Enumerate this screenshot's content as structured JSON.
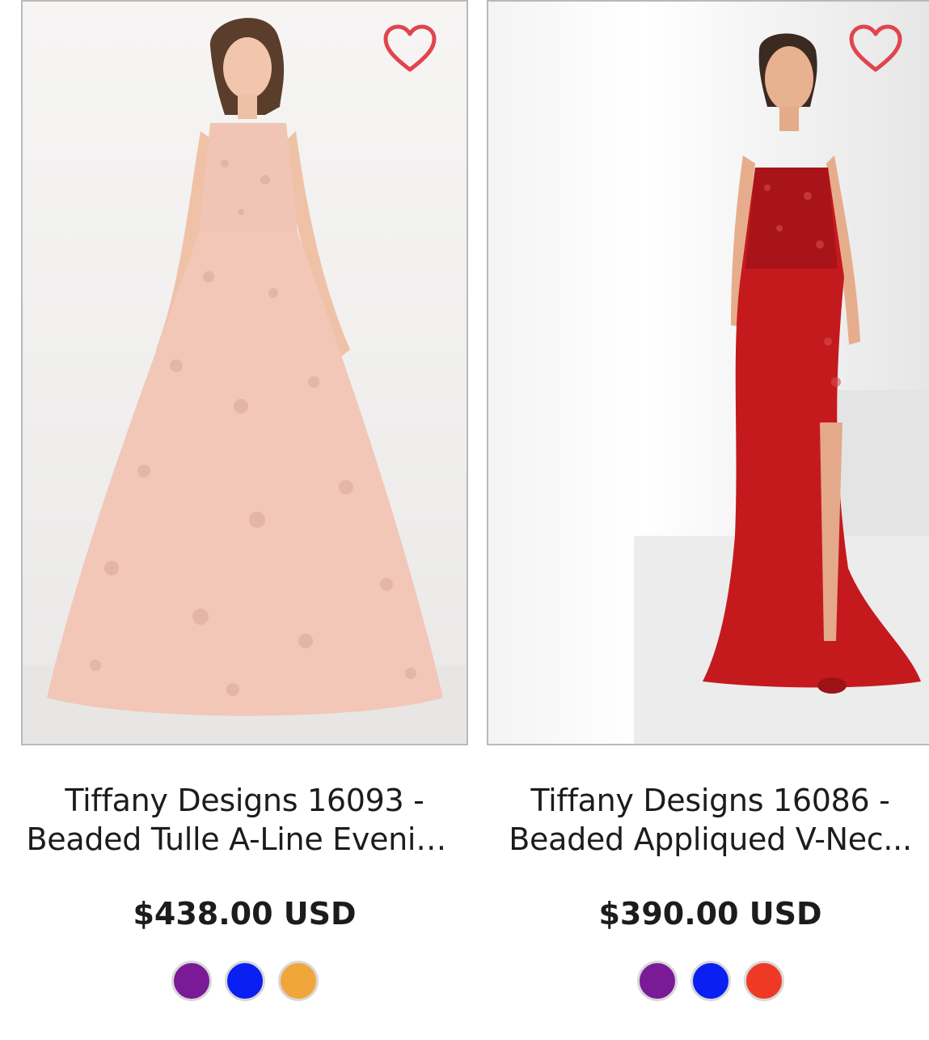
{
  "products": [
    {
      "title_line1": "Tiffany Designs 16093 -",
      "title_line2": "Beaded Tulle A-Line Evenin...",
      "price": "$438.00 USD",
      "swatches": [
        "#7a1a96",
        "#0a1ff2",
        "#f0a63a"
      ],
      "dress_color": "#f2c7b8"
    },
    {
      "title_line1": "Tiffany Designs 16086 -",
      "title_line2": "Beaded Appliqued V-Nec...",
      "price": "$390.00 USD",
      "swatches": [
        "#7a1a96",
        "#0a1ff2",
        "#ee3a24"
      ],
      "dress_color": "#c41a1e"
    }
  ],
  "wishlist_icon": "heart-outline-icon",
  "accent": "#e0454e"
}
